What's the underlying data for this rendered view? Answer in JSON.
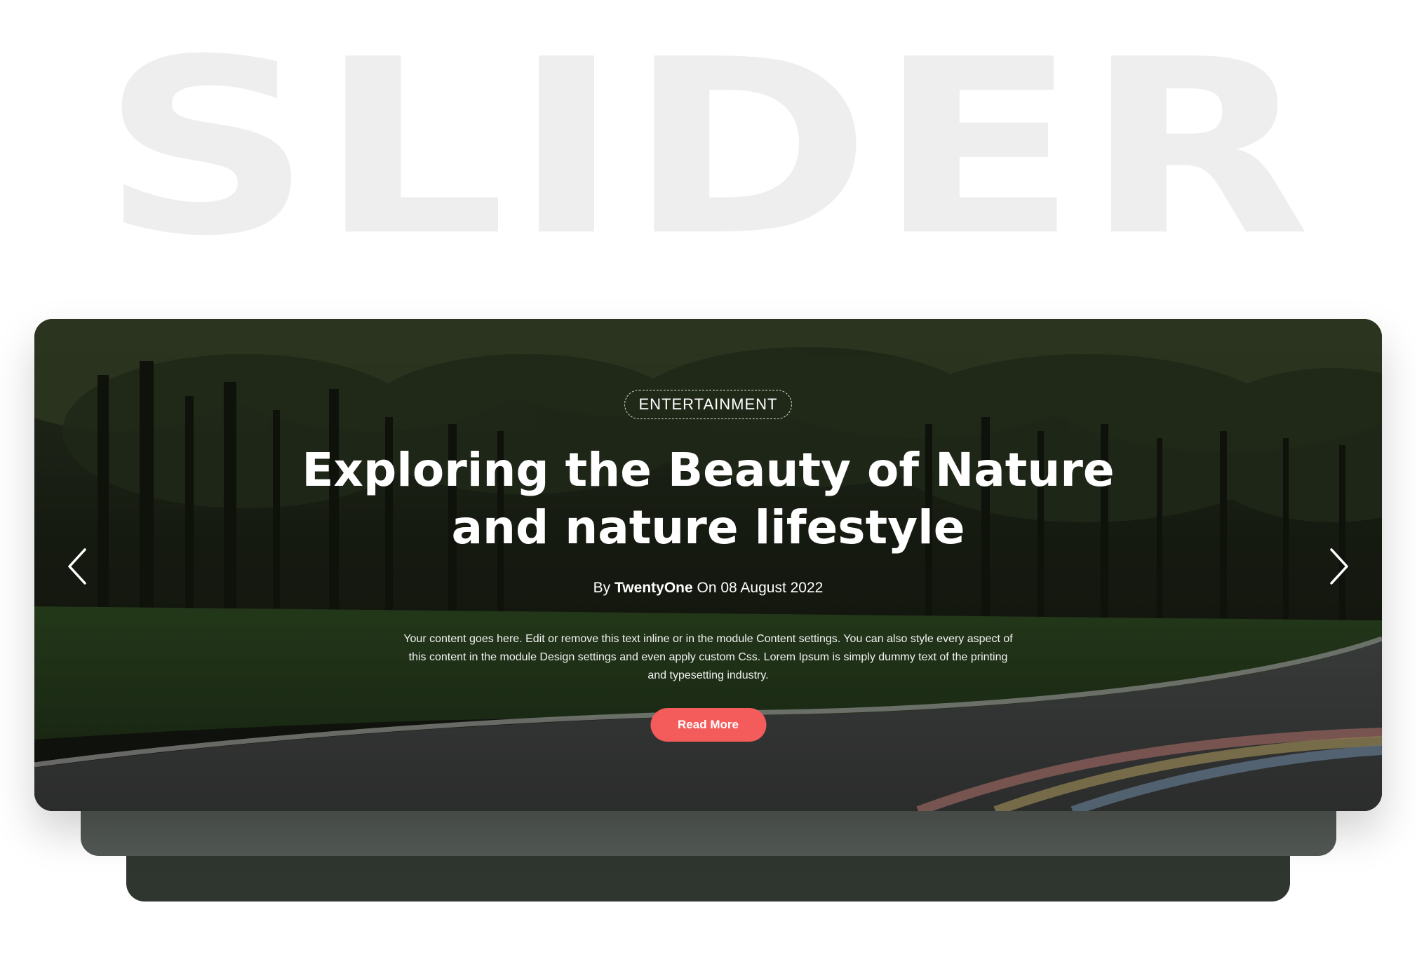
{
  "background_word": "SLIDER",
  "slide": {
    "category": "ENTERTAINMENT",
    "title_line1": "Exploring the Beauty of Nature",
    "title_line2": "and nature lifestyle",
    "byline": {
      "by": "By",
      "author": "TwentyOne",
      "on": "On",
      "date": "08 August 2022"
    },
    "body": "Your content goes here. Edit or remove this text inline or in the module Content settings. You can also style every aspect of this content in the module Design settings and even apply custom Css. Lorem Ipsum is simply dummy text of the printing and typesetting industry.",
    "button_label": "Read More"
  },
  "icons": {
    "prev": "chevron-left-icon",
    "next": "chevron-right-icon"
  },
  "colors": {
    "button": "#f45b5b",
    "background_word": "#eeeeee",
    "stack_mid": "#525854",
    "stack_back": "#2f3630"
  }
}
